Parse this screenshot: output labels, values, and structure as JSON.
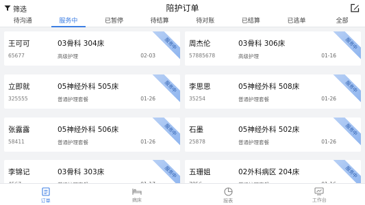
{
  "header": {
    "filter_label": "筛选",
    "title": "陪护订单"
  },
  "tabs": [
    {
      "label": "待沟通"
    },
    {
      "label": "服务中"
    },
    {
      "label": "已暂停"
    },
    {
      "label": "待结算"
    },
    {
      "label": "待对账"
    },
    {
      "label": "已结算"
    },
    {
      "label": "已逃单"
    },
    {
      "label": "全部"
    }
  ],
  "active_tab": "服务中",
  "orders": [
    {
      "name": "王可可",
      "id": "65677",
      "location": "03骨科 304床",
      "package": "高级护理",
      "date": "02-03",
      "status": "服务中"
    },
    {
      "name": "周杰伦",
      "id": "57885678",
      "location": "03骨科 306床",
      "package": "高级护理",
      "date": "01-16",
      "status": "服务中"
    },
    {
      "name": "立即就",
      "id": "325555",
      "location": "05神经外科 505床",
      "package": "普通护理套餐",
      "date": "01-26",
      "status": "服务中"
    },
    {
      "name": "李思思",
      "id": "35254",
      "location": "05神经外科 508床",
      "package": "普通护理套餐",
      "date": "01-26",
      "status": "服务中"
    },
    {
      "name": "张露露",
      "id": "58411",
      "location": "05神经外科 506床",
      "package": "普通护理套餐",
      "date": "01-26",
      "status": "服务中"
    },
    {
      "name": "石墨",
      "id": "25878",
      "location": "05神经外科 502床",
      "package": "普通护理套餐",
      "date": "01-26",
      "status": "服务中"
    },
    {
      "name": "李锦记",
      "id": "4567",
      "location": "03骨科 303床",
      "package": "普通护理套餐",
      "date": "01-17",
      "status": "服务中"
    },
    {
      "name": "五珊姐",
      "id": "7856",
      "location": "02外科病区 204床",
      "package": "普通护理套餐",
      "date": "01-16",
      "status": "服务中"
    }
  ],
  "bottom_nav": [
    {
      "label": "订单",
      "icon": "order-icon",
      "active": true
    },
    {
      "label": "病床",
      "icon": "bed-icon",
      "active": false
    },
    {
      "label": "报表",
      "icon": "report-icon",
      "active": false
    },
    {
      "label": "工作台",
      "icon": "workbench-icon",
      "active": false
    }
  ],
  "colors": {
    "accent": "#3b7de3",
    "background": "#f2f3f5",
    "ribbon": "#8ab2ee"
  }
}
